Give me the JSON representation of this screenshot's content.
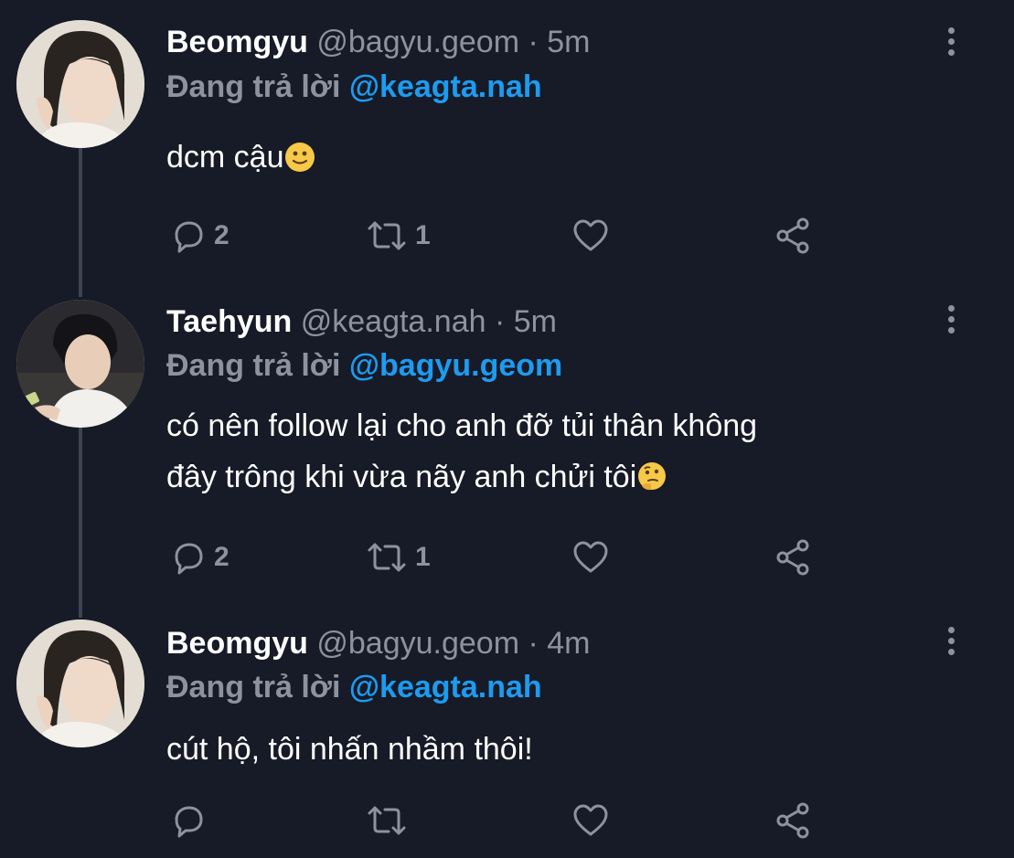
{
  "tweets": [
    {
      "name": "Beomgyu",
      "handle": "@bagyu.geom",
      "dot": "·",
      "time": "5m",
      "reply_prefix": "Đang trả lời",
      "reply_target": "@keagta.nah",
      "text_lines": [
        "dcm cậu"
      ],
      "emoji": "slightly-smiling-face",
      "replies": "2",
      "retweets": "1",
      "likes": "",
      "avatar": "beomgyu-avatar"
    },
    {
      "name": "Taehyun",
      "handle": "@keagta.nah",
      "dot": "·",
      "time": "5m",
      "reply_prefix": "Đang trả lời",
      "reply_target": "@bagyu.geom",
      "text_lines": [
        "có nên follow lại cho anh đỡ tủi thân không",
        "đây trông khi vừa nãy anh chửi tôi"
      ],
      "emoji": "thinking-face",
      "replies": "2",
      "retweets": "1",
      "likes": "",
      "avatar": "taehyun-avatar"
    },
    {
      "name": "Beomgyu",
      "handle": "@bagyu.geom",
      "dot": "·",
      "time": "4m",
      "reply_prefix": "Đang trả lời",
      "reply_target": "@keagta.nah",
      "text_lines": [
        "cút hộ, tôi nhấn nhầm thôi!"
      ],
      "emoji": "",
      "replies": "",
      "retweets": "",
      "likes": "",
      "avatar": "beomgyu-avatar"
    }
  ],
  "colors": {
    "background": "#171b27",
    "muted": "#8d939e",
    "accent": "#1d9bf0",
    "thread_line": "#3d4350"
  },
  "icons": [
    "reply-icon",
    "retweet-icon",
    "like-icon",
    "share-icon",
    "more-icon"
  ]
}
